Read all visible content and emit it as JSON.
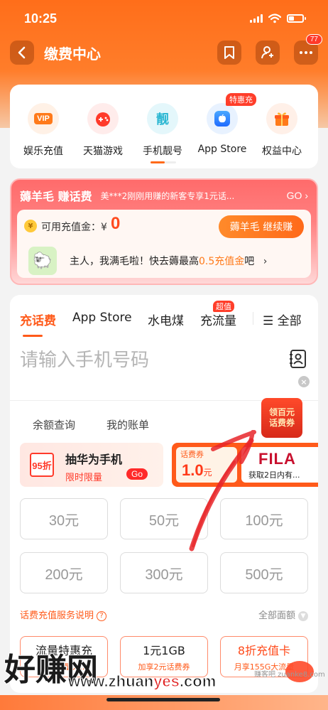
{
  "status_bar": {
    "time": "10:25"
  },
  "nav": {
    "title": "缴费中心",
    "badge_count": "77"
  },
  "quick_entries": [
    {
      "label": "娱乐充值",
      "icon": "vip-icon",
      "glyph": "VIP",
      "bg": "#fff1e6",
      "fg": "#ff6a1a"
    },
    {
      "label": "天猫游戏",
      "icon": "gamepad-icon",
      "glyph": "🎮",
      "bg": "#ffeceb",
      "fg": "#ff3a2a"
    },
    {
      "label": "手机靓号",
      "icon": "liang-icon",
      "glyph": "靓",
      "bg": "#e4f7fb",
      "fg": "#29b6d2"
    },
    {
      "label": "App Store",
      "icon": "apple-icon",
      "glyph": "",
      "bg": "#e8f2ff",
      "fg": "#1f7bff",
      "tag": "特惠充"
    },
    {
      "label": "权益中心",
      "icon": "gift-icon",
      "glyph": "🎁",
      "bg": "#fff0e8",
      "fg": "#ff6a1a"
    }
  ],
  "promo": {
    "title": "薅羊毛 赚话费",
    "scroll_text": "美***2刚刚用赚的新客专享1元话...",
    "go": "GO",
    "balance_label": "可用充值金：¥",
    "balance_value": "0",
    "earn_button": "薅羊毛 继续赚",
    "sheep_text_1": "主人，我满毛啦！快去薅最高",
    "sheep_text_highlight": "0.5充值金",
    "sheep_text_2": "吧"
  },
  "tabs": {
    "items": [
      "充话费",
      "App Store",
      "水电煤",
      "充流量"
    ],
    "active": "充话费",
    "tag": "超值",
    "all": "全部"
  },
  "phone": {
    "placeholder": "请输入手机号码"
  },
  "links": [
    "余额查询",
    "我的账单"
  ],
  "coupon_float": {
    "line1": "领百元",
    "line2": "话费券"
  },
  "banner_huawei": {
    "chip": "95折",
    "title": "抽华为手机",
    "sub": "限时限量",
    "go": "Go"
  },
  "banner_fila": {
    "coupon_label": "话费券",
    "coupon_value": "1.0",
    "coupon_unit": "元",
    "brand": "FILA",
    "desc": "获取2日内有..."
  },
  "amounts": [
    "30元",
    "50元",
    "100元",
    "200元",
    "300元",
    "500元"
  ],
  "service": {
    "left": "话费充值服务说明",
    "right": "全部面额"
  },
  "packs": [
    {
      "title": "流量特惠充",
      "sub": "特惠流量大..."
    },
    {
      "title": "1元1GB",
      "sub": "加享2元话费券"
    },
    {
      "title": "8折充值卡",
      "sub": "月享155G大流量"
    }
  ],
  "watermark": {
    "big": "好赚网",
    "url_1": "www.zhuan",
    "url_2": "yes",
    "url_3": ".com",
    "small": "赚客吧 zuanke8.com"
  },
  "colors": {
    "accent": "#ff6a1a",
    "red": "#ff3a2a"
  }
}
